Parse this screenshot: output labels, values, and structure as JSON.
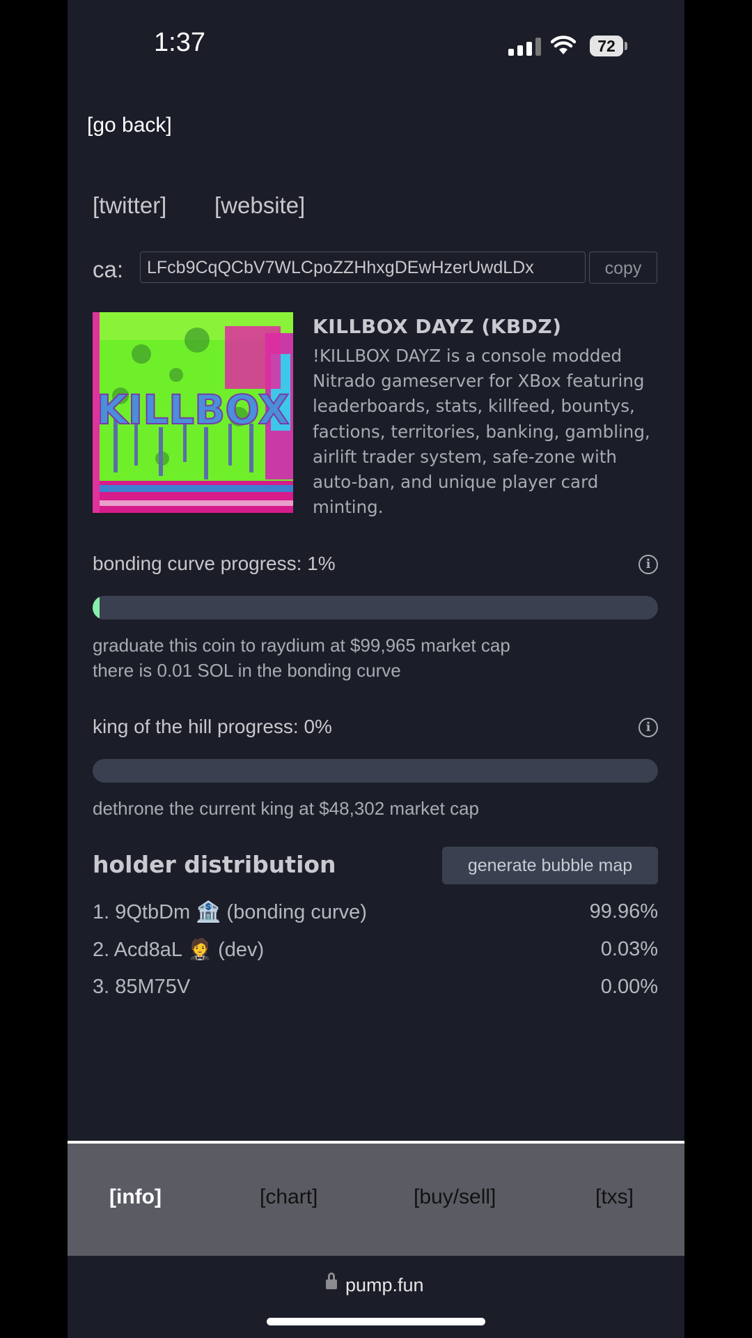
{
  "status_bar": {
    "time": "1:37",
    "battery": "72"
  },
  "nav": {
    "go_back": "[go back]"
  },
  "links": {
    "twitter": "[twitter]",
    "website": "[website]"
  },
  "contract": {
    "label": "ca:",
    "address": "LFcb9CqQCbV7WLCpoZZHhxgDEwHzerUwdLDx",
    "copy_label": "copy"
  },
  "coin": {
    "title": "KILLBOX DAYZ (KBDZ)",
    "description": "!KILLBOX DAYZ is a console modded Nitrado gameserver for XBox featuring leaderboards, stats, killfeed, bountys, factions, territories, banking, gambling, airlift trader system, safe-zone with auto-ban, and unique player card minting.",
    "image_text": "KILLBOX"
  },
  "bonding_curve": {
    "label": "bonding curve progress: 1%",
    "progress": 0.01,
    "line1": "graduate this coin to raydium at $99,965 market cap",
    "line2": "there is 0.01 SOL in the bonding curve"
  },
  "king_of_hill": {
    "label": "king of the hill progress: 0%",
    "progress": 0,
    "line1": "dethrone the current king at $48,302 market cap"
  },
  "holders": {
    "title": "holder distribution",
    "bubble_button": "generate bubble map",
    "rows": [
      {
        "name": "1. 9QtbDm 🏦 (bonding curve)",
        "pct": "99.96%"
      },
      {
        "name": "2. Acd8aL 🤵 (dev)",
        "pct": "0.03%"
      },
      {
        "name": "3. 85M75V",
        "pct": "0.00%"
      }
    ]
  },
  "tabs": [
    "[info]",
    "[chart]",
    "[buy/sell]",
    "[txs]"
  ],
  "browser": {
    "url": "pump.fun"
  },
  "colors": {
    "background": "#1b1d28",
    "progress_fill": "#86efac",
    "bar_track": "#3a4050",
    "tab_bar": "#5b5c63"
  }
}
